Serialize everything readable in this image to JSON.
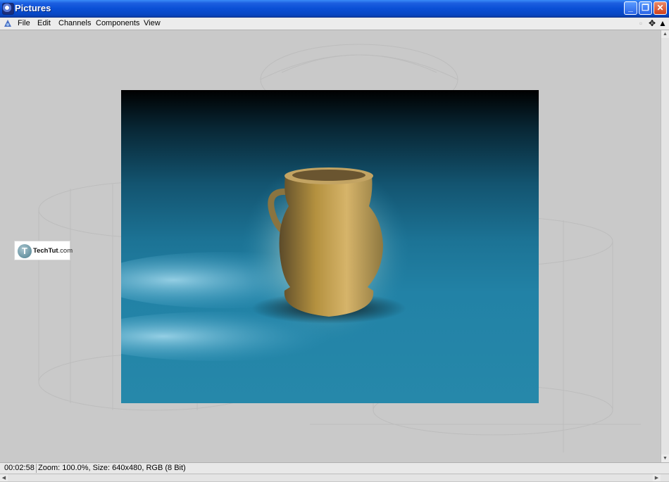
{
  "window": {
    "title": "Pictures"
  },
  "title_buttons": {
    "minimize": "_",
    "maximize": "❐",
    "close": "✕"
  },
  "menu": {
    "items": [
      "File",
      "Edit",
      "Channels",
      "Components",
      "View"
    ]
  },
  "toolbar_icons": [
    "move-icon",
    "navigate-icon"
  ],
  "watermark": {
    "brand": "TechTut",
    "suffix": ".com",
    "logo_letter": "T"
  },
  "status": {
    "time": "00:02:58",
    "info": "Zoom: 100.0%, Size: 640x480, RGB (8 Bit)"
  },
  "colors": {
    "titlebar": "#0a4fd6",
    "close_button": "#d0401c",
    "viewport_bg": "#c9c9c9"
  }
}
